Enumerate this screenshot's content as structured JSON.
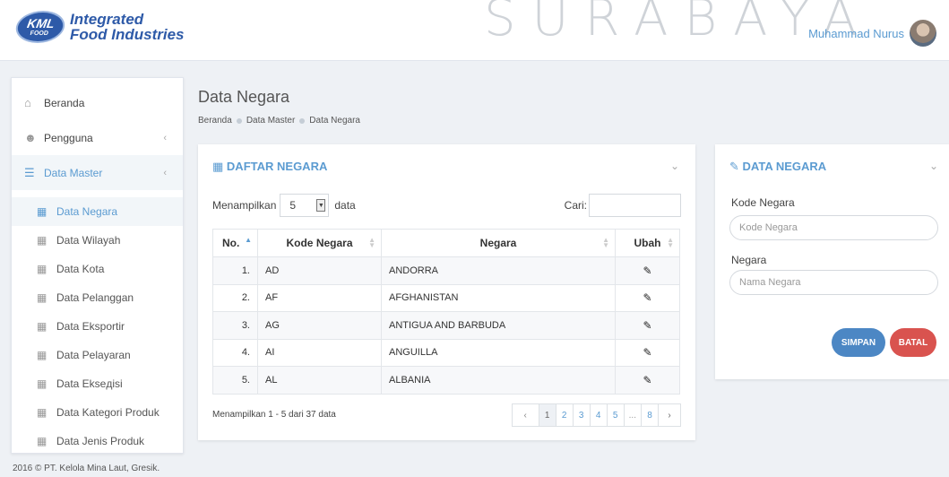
{
  "header": {
    "logo_badge": "KML",
    "logo_badge_sub": "FOOD",
    "logo_line1": "Integrated",
    "logo_line2": "Food Industries",
    "watermark": "SURABAYA",
    "user_name": "Muhammad Nurus"
  },
  "sidebar": {
    "items": [
      {
        "label": "Beranda",
        "icon": "home-icon"
      },
      {
        "label": "Pengguna",
        "icon": "users-icon"
      },
      {
        "label": "Data Master",
        "icon": "database-icon"
      }
    ],
    "subitems": [
      "Data Negara",
      "Data Wilayah",
      "Data Kota",
      "Data Pelanggan",
      "Data Eksportir",
      "Data Pelayaran",
      "Data Ekseдisi",
      "Data Kategori Produk",
      "Data Jenis Produk"
    ]
  },
  "page": {
    "title": "Data Negara",
    "breadcrumb": [
      "Beranda",
      "Data Master",
      "Data Negara"
    ]
  },
  "list": {
    "title": "DAFTAR NEGARA",
    "show_label": "Menampilkan",
    "show_value": "5",
    "show_suffix": "data",
    "search_label": "Cari:",
    "columns": [
      "No.",
      "Kode Negara",
      "Negara",
      "Ubah"
    ],
    "rows": [
      {
        "no": "1.",
        "kode": "AD",
        "negara": "ANDORRA"
      },
      {
        "no": "2.",
        "kode": "AF",
        "negara": "AFGHANISTAN"
      },
      {
        "no": "3.",
        "kode": "AG",
        "negara": "ANTIGUA AND BARBUDA"
      },
      {
        "no": "4.",
        "kode": "AI",
        "negara": "ANGUILLA"
      },
      {
        "no": "5.",
        "kode": "AL",
        "negara": "ALBANIA"
      }
    ],
    "info": "Menampilkan 1 - 5 dari 37 data",
    "pager": [
      "‹",
      "1",
      "2",
      "3",
      "4",
      "5",
      "...",
      "8",
      "›"
    ]
  },
  "form": {
    "title": "DATA NEGARA",
    "kode_label": "Kode Negara",
    "kode_placeholder": "Kode Negara",
    "negara_label": "Negara",
    "negara_placeholder": "Nama Negara",
    "save": "SIMPAN",
    "cancel": "BATAL"
  },
  "footer": "2016 © PT. Kelola Mina Laut, Gresik."
}
